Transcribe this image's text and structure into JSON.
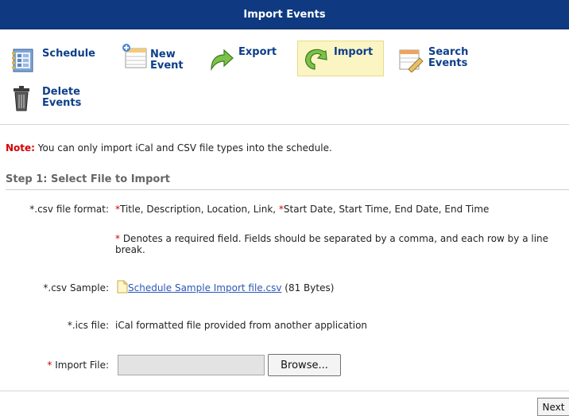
{
  "header": {
    "title": "Import Events"
  },
  "toolbar": {
    "schedule": "Schedule",
    "new_event_1": "New",
    "new_event_2": "Event",
    "export": "Export",
    "import": "Import",
    "search_events_1": "Search",
    "search_events_2": "Events",
    "delete_events_1": "Delete",
    "delete_events_2": "Events"
  },
  "note": {
    "label": "Note:",
    "text": " You can only import iCal and CSV file types into the schedule."
  },
  "step1": {
    "title": "Step 1: Select File to Import"
  },
  "csv_format": {
    "label": "*.csv file format:",
    "req_mark": "*",
    "part1": "Title, Description, Location, Link, ",
    "part2": "Start Date, Start Time, End Date, End Time",
    "note_mark": "*",
    "note_text": " Denotes a required field. Fields should be separated by a comma, and each row by a line break."
  },
  "csv_sample": {
    "label": "*.csv Sample:",
    "link": "Schedule Sample Import file.csv",
    "size": " (81 Bytes)"
  },
  "ics": {
    "label": "*.ics file:",
    "text": "iCal formatted file provided from another application"
  },
  "import_file": {
    "req_mark": "*",
    "label": " Import File:",
    "value": "",
    "browse_label": "Browse..."
  },
  "footer": {
    "next_label": "Next"
  },
  "colors": {
    "header_bg": "#0f3a82",
    "active_bg": "#fbf5c4",
    "required": "#d60000",
    "link": "#2e57b8"
  }
}
